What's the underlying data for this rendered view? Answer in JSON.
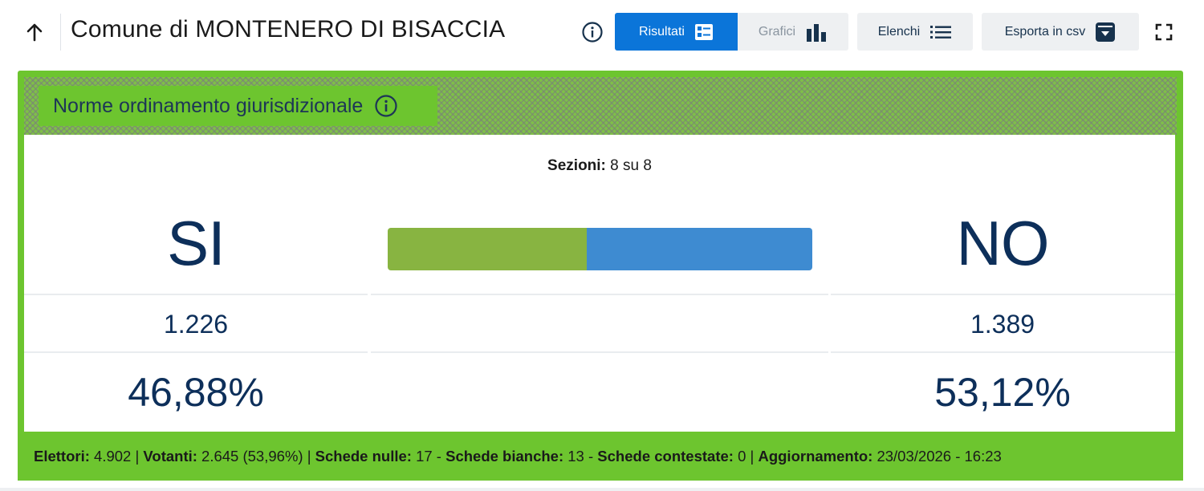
{
  "header": {
    "title": "Comune di MONTENERO DI BISACCIA",
    "tabs": [
      {
        "label": "Risultati",
        "active": true
      },
      {
        "label": "Grafici",
        "active": false
      }
    ],
    "elenchi_label": "Elenchi",
    "export_label": "Esporta in csv"
  },
  "card": {
    "title": "Norme ordinamento giurisdizionale",
    "accent_color": "#6dc52f",
    "sezioni_label": "Sezioni:",
    "sezioni_value": "8 su 8",
    "si": {
      "label": "SI",
      "votes": "1.226",
      "percent": "46,88%",
      "share": 0.4688,
      "color": "#88b441"
    },
    "no": {
      "label": "NO",
      "votes": "1.389",
      "percent": "53,12%",
      "share": 0.5312,
      "color": "#3e8bd1"
    }
  },
  "footer": {
    "elettori_label": "Elettori:",
    "elettori_value": "4.902",
    "votanti_label": "Votanti:",
    "votanti_value": "2.645 (53,96%)",
    "nulle_label": "Schede nulle:",
    "nulle_value": "17",
    "bianche_label": "Schede bianche:",
    "bianche_value": "13",
    "contestate_label": "Schede contestate:",
    "contestate_value": "0",
    "aggiornamento_label": "Aggiornamento:",
    "aggiornamento_value": "23/03/2026 - 16:23"
  }
}
